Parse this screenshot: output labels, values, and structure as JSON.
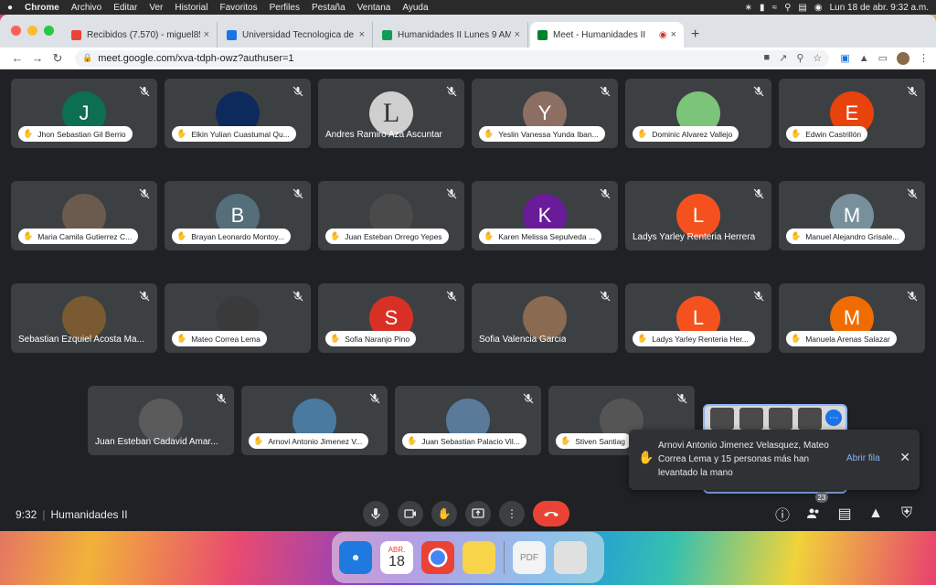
{
  "menubar": {
    "apple": "",
    "app": "Chrome",
    "items": [
      "Archivo",
      "Editar",
      "Ver",
      "Historial",
      "Favoritos",
      "Perfiles",
      "Pestaña",
      "Ventana",
      "Ayuda"
    ],
    "datetime": "Lun 18 de abr.  9:32 a.m."
  },
  "tabs": [
    {
      "title": "Recibidos (7.570) - miguel85@",
      "fav": "gmail"
    },
    {
      "title": "Universidad Tecnologica de Pe",
      "fav": "utp"
    },
    {
      "title": "Humanidades II Lunes 9 AM - ",
      "fav": "classroom"
    },
    {
      "title": "Meet - Humanidades II",
      "fav": "meet"
    }
  ],
  "url": "meet.google.com/xva-tdph-owz?authuser=1",
  "participants": [
    {
      "name": "Jhon Sebastian Gil Berrio",
      "initial": "J",
      "color": "#0b6f50",
      "pill": true
    },
    {
      "name": "Elkin Yulian Cuastumal Qu...",
      "initial": "",
      "color": "#0e2a5c",
      "pill": true
    },
    {
      "name": "Andres Ramiro Aza Ascuntar",
      "initial": "L",
      "color": "#cfcfcf",
      "pill": false
    },
    {
      "name": "Yeslin Vanessa Yunda Iban...",
      "initial": "Y",
      "color": "#8d6e63",
      "pill": true
    },
    {
      "name": "Dominic Alvarez Vallejo",
      "initial": "",
      "color": "#7cc47a",
      "pill": true
    },
    {
      "name": "Edwin Castrillón",
      "initial": "E",
      "color": "#e8430c",
      "pill": true
    },
    {
      "name": "Maria Camila Gutierrez C...",
      "initial": "",
      "color": "#6b5a4e",
      "pill": true
    },
    {
      "name": "Brayan Leonardo Montoy...",
      "initial": "B",
      "color": "#546e7a",
      "pill": true
    },
    {
      "name": "Juan Esteban Orrego Yepes",
      "initial": "",
      "color": "#4a4a4a",
      "pill": true
    },
    {
      "name": "Karen Melissa Sepulveda ...",
      "initial": "K",
      "color": "#6a1b9a",
      "pill": true
    },
    {
      "name": "Ladys Yarley Renteria Herrera",
      "initial": "L",
      "color": "#f4511e",
      "pill": false
    },
    {
      "name": "Manuel Alejandro Grisale...",
      "initial": "M",
      "color": "#78909c",
      "pill": true
    },
    {
      "name": "Sebastian Ezquiel Acosta Ma...",
      "initial": "",
      "color": "#7a5a30",
      "pill": false
    },
    {
      "name": "Mateo Correa Lema",
      "initial": "",
      "color": "#3a3a3a",
      "pill": true
    },
    {
      "name": "Sofia Naranjo Pino",
      "initial": "S",
      "color": "#d93025",
      "pill": true
    },
    {
      "name": "Sofia Valencia Garcia",
      "initial": "",
      "color": "#8a6a50",
      "pill": false
    },
    {
      "name": "Ladys Yarley Renteria Her...",
      "initial": "L",
      "color": "#f4511e",
      "pill": true
    },
    {
      "name": "Manuela Arenas Salazar",
      "initial": "M",
      "color": "#ef6c00",
      "pill": true
    },
    {
      "name": "Juan Esteban Cadavid Amar...",
      "initial": "",
      "color": "#5a5a5a",
      "pill": false
    },
    {
      "name": "Arnovi Antonio Jimenez V...",
      "initial": "",
      "color": "#4a7aa0",
      "pill": true
    },
    {
      "name": "Juan Sebastian Palacio Vil...",
      "initial": "",
      "color": "#5a7a9a",
      "pill": true
    },
    {
      "name": "Stiven Santiag",
      "initial": "",
      "color": "#555555",
      "pill": true
    }
  ],
  "toast": {
    "message": "Arnovi Antonio Jimenez Velasquez, Mateo Correa Lema y 15 personas más han levantado la mano",
    "action": "Abrir fila"
  },
  "meeting": {
    "time": "9:32",
    "name": "Humanidades II",
    "people_count": "23"
  },
  "dock": {
    "calendar_month": "ABR.",
    "calendar_day": "18"
  }
}
